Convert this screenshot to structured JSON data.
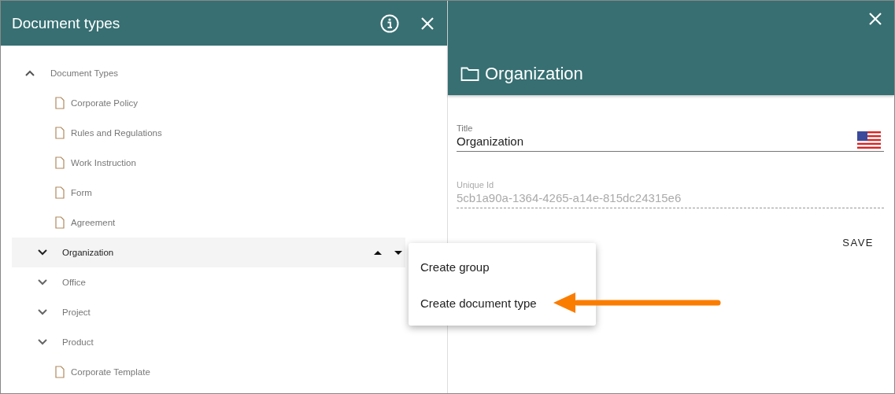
{
  "left_panel": {
    "title": "Document types",
    "tree": {
      "label": "Document Types",
      "expanded": true,
      "selected": false,
      "children": [
        {
          "kind": "document",
          "label": "Corporate Policy",
          "selected": false
        },
        {
          "kind": "document",
          "label": "Rules and Regulations",
          "selected": false
        },
        {
          "kind": "document",
          "label": "Work Instruction",
          "selected": false
        },
        {
          "kind": "document",
          "label": "Form",
          "selected": false
        },
        {
          "kind": "document",
          "label": "Agreement",
          "selected": false
        },
        {
          "kind": "group",
          "label": "Organization",
          "expanded": false,
          "selected": true
        },
        {
          "kind": "group",
          "label": "Office",
          "expanded": false,
          "selected": false
        },
        {
          "kind": "group",
          "label": "Project",
          "expanded": false,
          "selected": false
        },
        {
          "kind": "group",
          "label": "Product",
          "expanded": false,
          "selected": false
        },
        {
          "kind": "document",
          "label": "Corporate Template",
          "selected": false
        }
      ]
    }
  },
  "right_panel": {
    "title": "Organization",
    "fields": [
      {
        "kind": "editable",
        "label": "Title",
        "value": "Organization"
      },
      {
        "kind": "readonly",
        "label": "Unique Id",
        "value": "5cb1a90a-1364-4265-a14e-815dc24315e6"
      }
    ],
    "buttons": [
      "SAVE"
    ]
  },
  "context_menu": {
    "items": [
      "Create group",
      "Create document type"
    ]
  }
}
